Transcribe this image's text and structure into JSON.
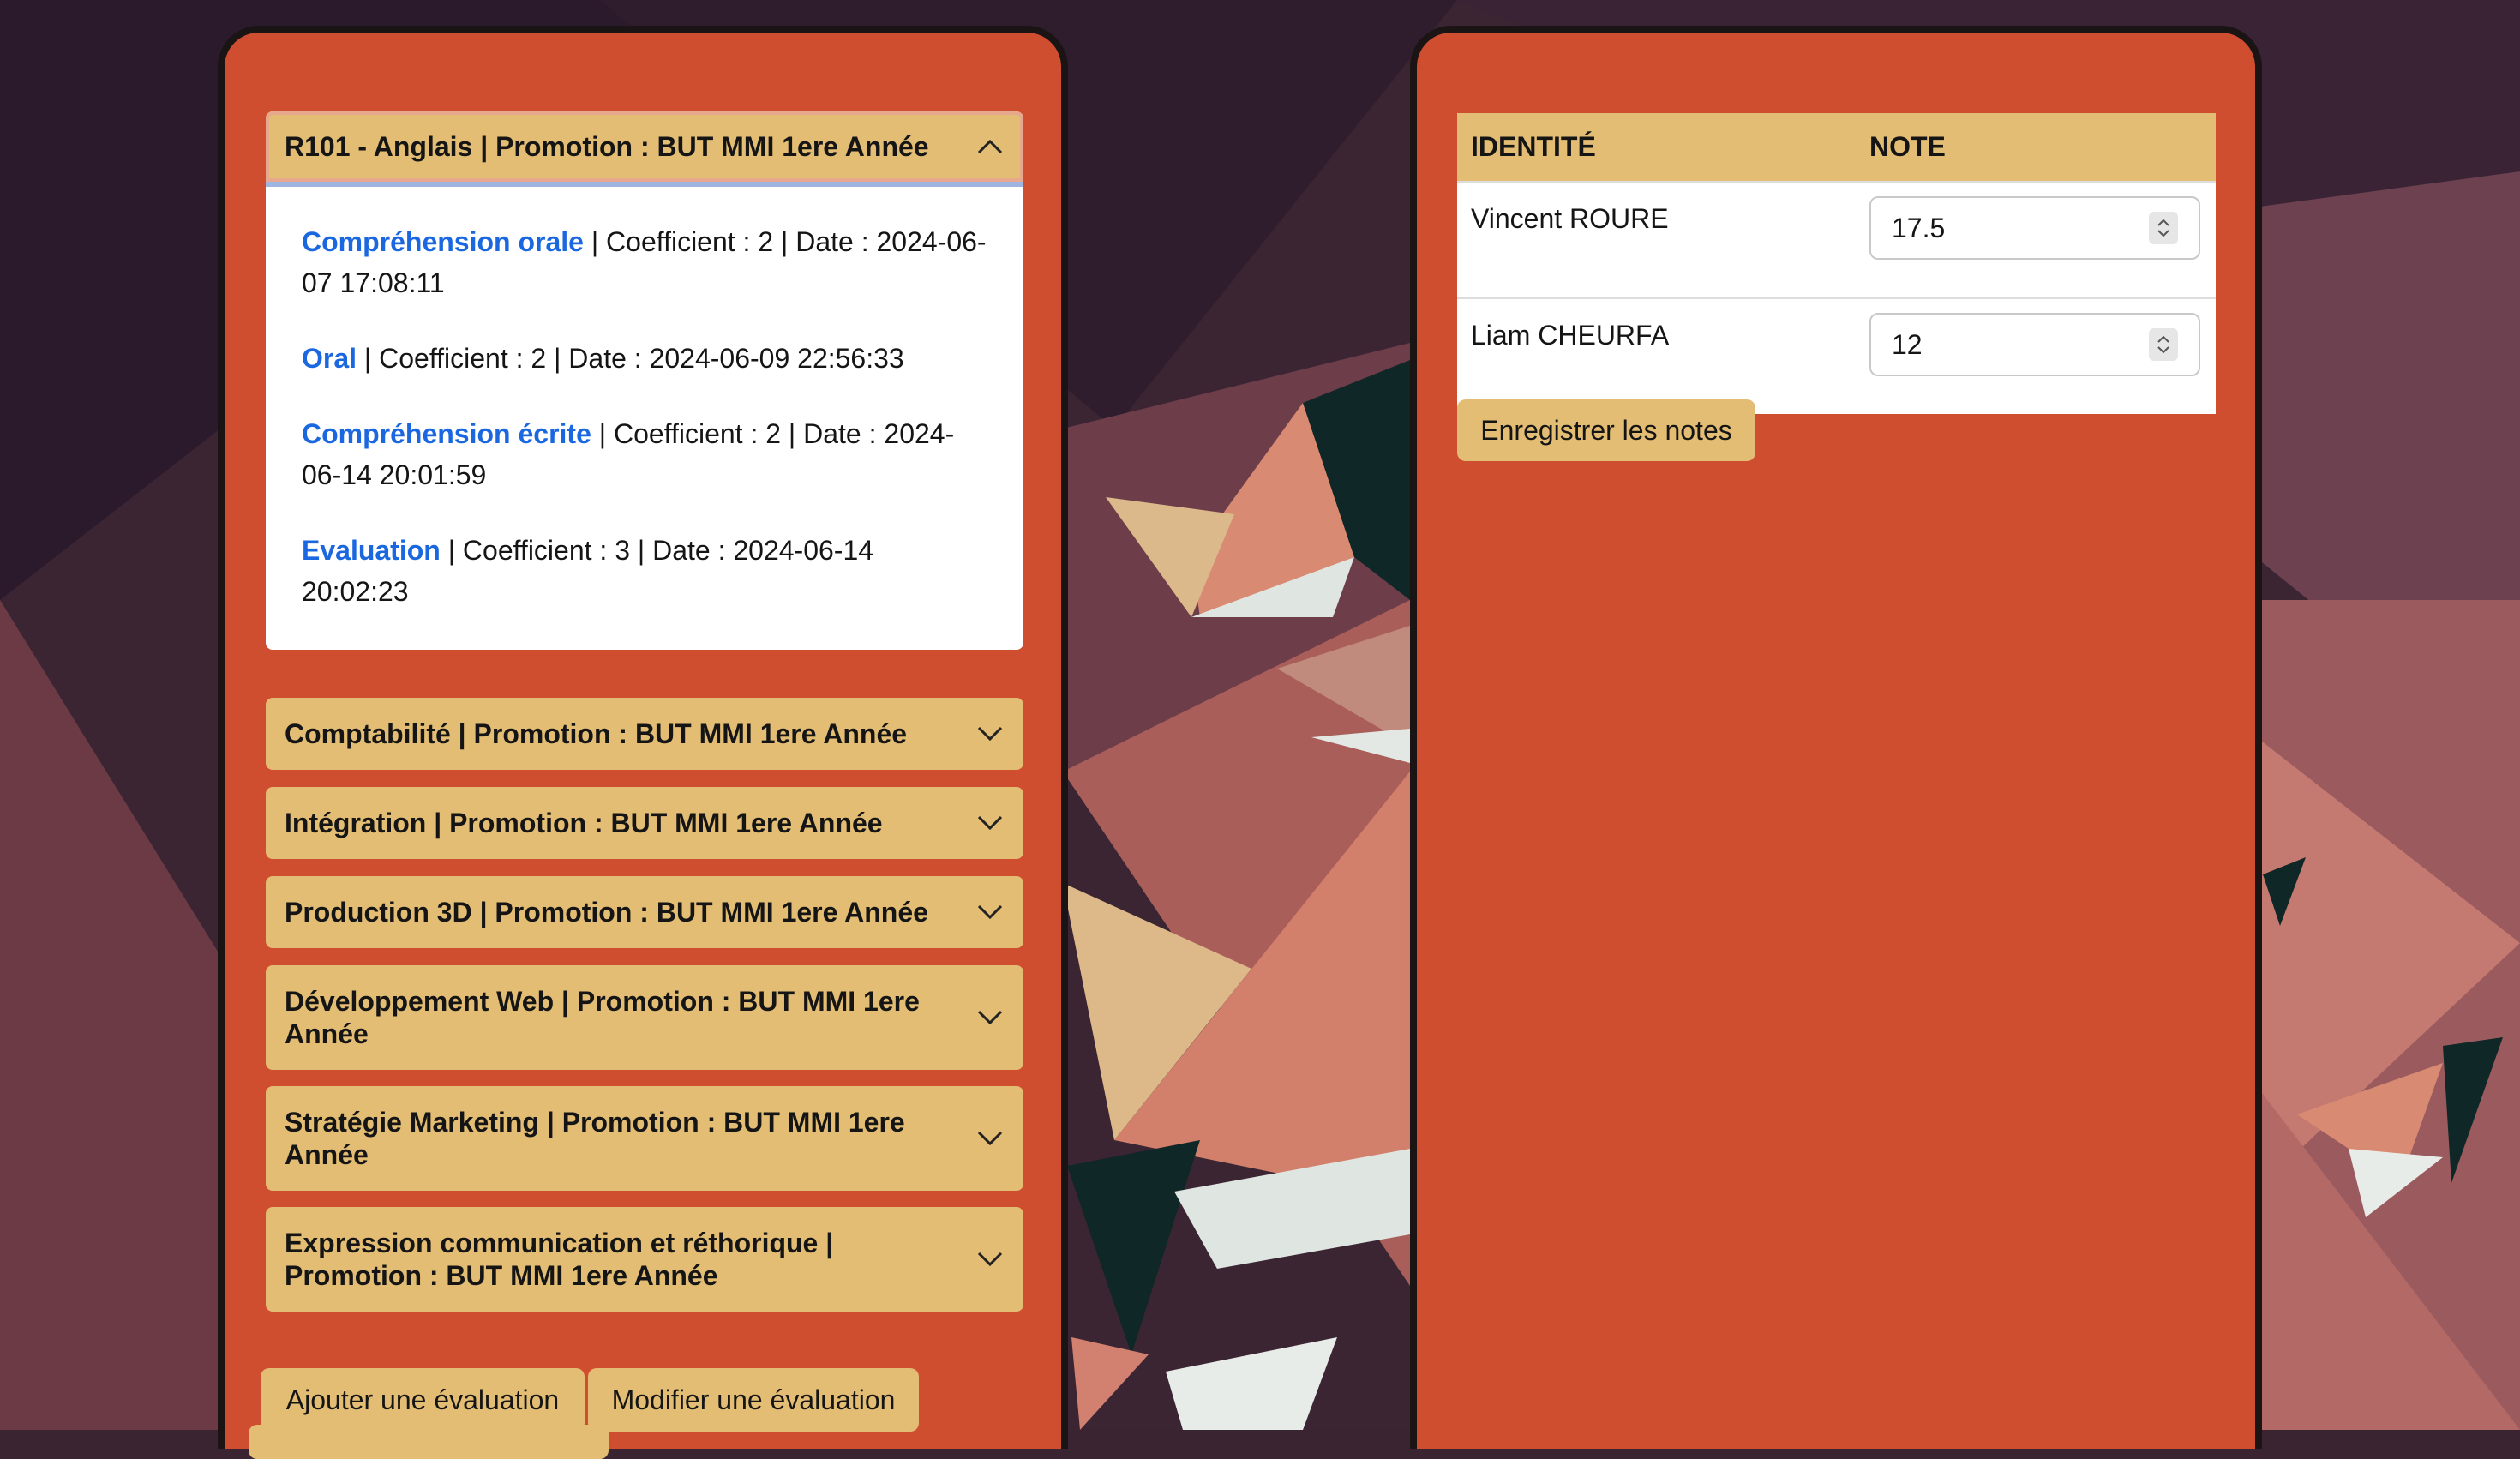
{
  "left_panel": {
    "open_course": {
      "title": "R101 - Anglais | Promotion : BUT MMI 1ere Année",
      "evaluations": [
        {
          "name": "Compréhension orale",
          "details": " | Coefficient : 2 | Date : 2024-06-07 17:08:11"
        },
        {
          "name": "Oral",
          "details": " | Coefficient : 2 | Date : 2024-06-09 22:56:33"
        },
        {
          "name": "Compréhension écrite",
          "details": " | Coefficient : 2 | Date : 2024-06-14 20:01:59"
        },
        {
          "name": "Evaluation",
          "details": " | Coefficient : 3 | Date : 2024-06-14 20:02:23"
        }
      ]
    },
    "courses": [
      {
        "title": "Comptabilité | Promotion : BUT MMI 1ere Année"
      },
      {
        "title": "Intégration | Promotion : BUT MMI 1ere Année"
      },
      {
        "title": "Production 3D | Promotion : BUT MMI 1ere Année"
      },
      {
        "title": "Développement Web | Promotion : BUT MMI 1ere Année"
      },
      {
        "title": "Stratégie Marketing | Promotion : BUT MMI 1ere Année"
      },
      {
        "title": "Expression communication et réthorique | Promotion : BUT MMI 1ere Année"
      }
    ],
    "add_button": "Ajouter une évaluation",
    "edit_button": "Modifier une évaluation"
  },
  "right_panel": {
    "table": {
      "headers": [
        "IDENTITÉ",
        "NOTE"
      ],
      "rows": [
        {
          "identity": "Vincent ROURE",
          "note": "17.5"
        },
        {
          "identity": "Liam CHEURFA",
          "note": "12"
        }
      ]
    },
    "save_button": "Enregistrer les notes"
  },
  "colors": {
    "panel": "#cf4e30",
    "accent": "#e3bd73",
    "link": "#1a67e0"
  },
  "icons": {
    "accordion_open": "chevron-up-icon",
    "accordion_closed": "chevron-down-icon",
    "number_spinner": "spinner-arrows-icon"
  }
}
